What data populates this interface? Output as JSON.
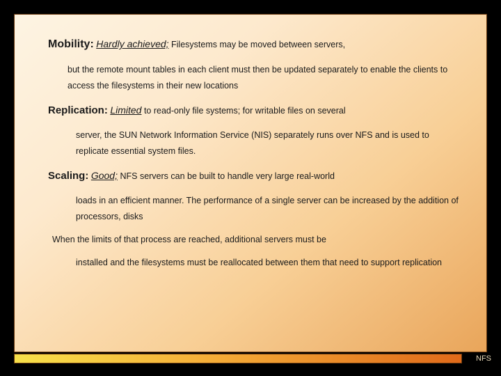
{
  "mobility": {
    "title": "Mobility:",
    "qualifier": "Hardly achieved;",
    "tail": " Filesystems may be moved between servers,",
    "cont": "but the remote mount tables in each client must then be updated separately to enable the clients to access the filesystems in their new locations"
  },
  "replication": {
    "title": "Replication:",
    "qualifier": " Limited",
    "tail": " to read-only file systems; for writable files on several",
    "cont": "server, the SUN Network Information Service (NIS) separately  runs over NFS and is used to replicate essential system files."
  },
  "scaling": {
    "title": "Scaling:",
    "qualifier": " Good;",
    "tail": " NFS servers can be built to handle very large real-world",
    "cont": "loads in an     efficient  manner. The performance of a single server can be increased by the addition of processors, disks"
  },
  "limits": {
    "line1": "When the limits of that process are reached, additional servers must be",
    "cont": "installed and the filesystems must be reallocated between them that  need to support  replication"
  },
  "footer": "NFS"
}
